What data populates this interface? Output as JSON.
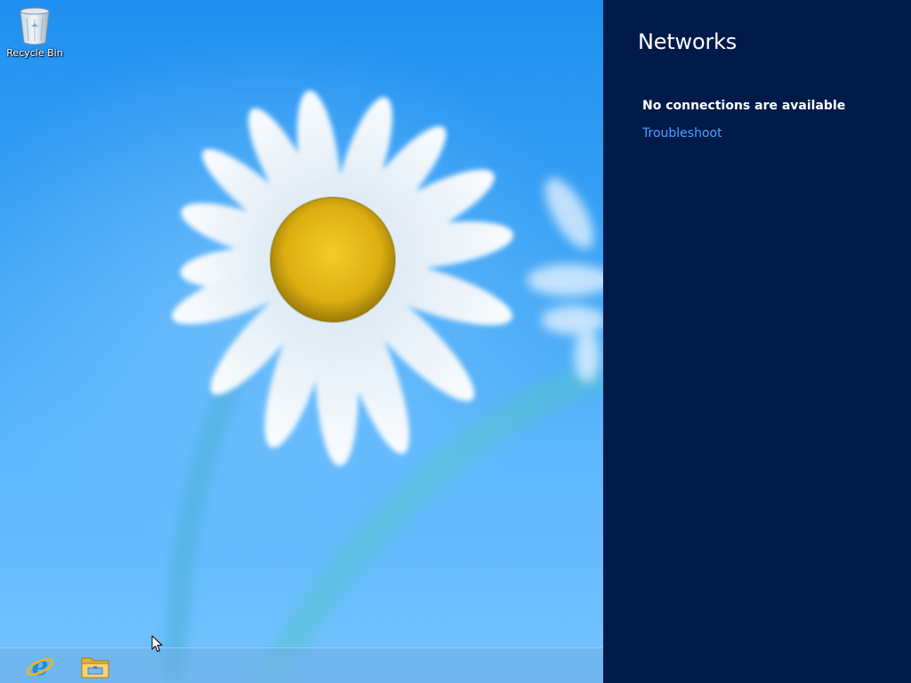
{
  "desktop": {
    "icons": [
      {
        "label": "Recycle Bin",
        "icon": "recycle-bin-icon"
      }
    ],
    "colors": {
      "sky_top": "#1f8ff0",
      "sky_bottom": "#74c2ff",
      "petal": "#ffffff",
      "flower_center": "#e8b812"
    }
  },
  "taskbar": {
    "buttons": [
      {
        "icon": "internet-explorer-icon"
      },
      {
        "icon": "file-explorer-icon"
      }
    ]
  },
  "networks_panel": {
    "title": "Networks",
    "status": "No connections are available",
    "troubleshoot_label": "Troubleshoot",
    "colors": {
      "background": "#001a4a",
      "link": "#4aa3ff"
    }
  }
}
